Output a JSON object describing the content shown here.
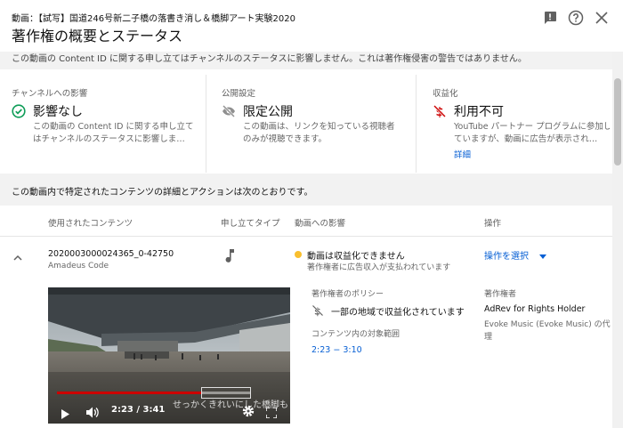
{
  "header": {
    "video_title": "動画：【試写】国道246号新二子橋の落書き消し＆橋脚アート実験2020",
    "page_title": "著作権の概要とステータス",
    "icons": [
      "feedback-icon",
      "help-icon",
      "close-icon"
    ]
  },
  "banner": {
    "text": "この動画の Content ID に関する申し立てはチャンネルのステータスに影響しません。これは著作権侵害の警告ではありません。"
  },
  "cards": {
    "channel": {
      "label": "チャンネルへの影響",
      "value": "影響なし",
      "desc_line1": "この動画の Content ID に関する申し立て",
      "desc_line2": "はチャンネルのステータスに影響しま…",
      "icon": "check-circle-icon",
      "color": "#0f9d58"
    },
    "visibility": {
      "label": "公開設定",
      "value": "限定公開",
      "desc_line1": "この動画は、リンクを知っている視聴者",
      "desc_line2": "のみが視聴できます。",
      "icon": "eye-off-icon"
    },
    "monetization": {
      "label": "収益化",
      "value": "利用不可",
      "desc_line1": "YouTube パートナー プログラムに参加し",
      "desc_line2": "ていますが、動画に広告が表示され…",
      "link": "詳細",
      "icon": "dollar-off-icon",
      "color": "#cc0000"
    }
  },
  "section_header": "この動画内で特定されたコンテンツの詳細とアクションは次のとおりです。",
  "table": {
    "columns": [
      "使用されたコンテンツ",
      "申し立てタイプ",
      "動画への影響",
      "操作"
    ],
    "row": {
      "content_id": "2020003000024365_0-42750",
      "content_owner": "Amadeus Code",
      "claim_type_icon": "music-note-icon",
      "impact_title": "動画は収益化できません",
      "impact_desc": "著作権者に広告収入が支払われています",
      "impact_dot_color": "#f9bf2e",
      "action_label": "操作を選択"
    }
  },
  "details": {
    "policy_label": "著作権者のポリシー",
    "policy_value": "一部の地域で収益化されています",
    "range_label": "コンテンツ内の対象範囲",
    "range_value": "2:23 − 3:10",
    "owner_label": "著作権者",
    "owner_name": "AdRev for Rights Holder",
    "owner_line2": "Evoke Music (Evoke Music) の代",
    "owner_line3": "理"
  },
  "video": {
    "subtitle": "せっかくきれいにした橋脚も",
    "time": "2:23 / 3:41",
    "progress": 0.634,
    "claim_start": 0.634,
    "claim_end": 0.855
  }
}
